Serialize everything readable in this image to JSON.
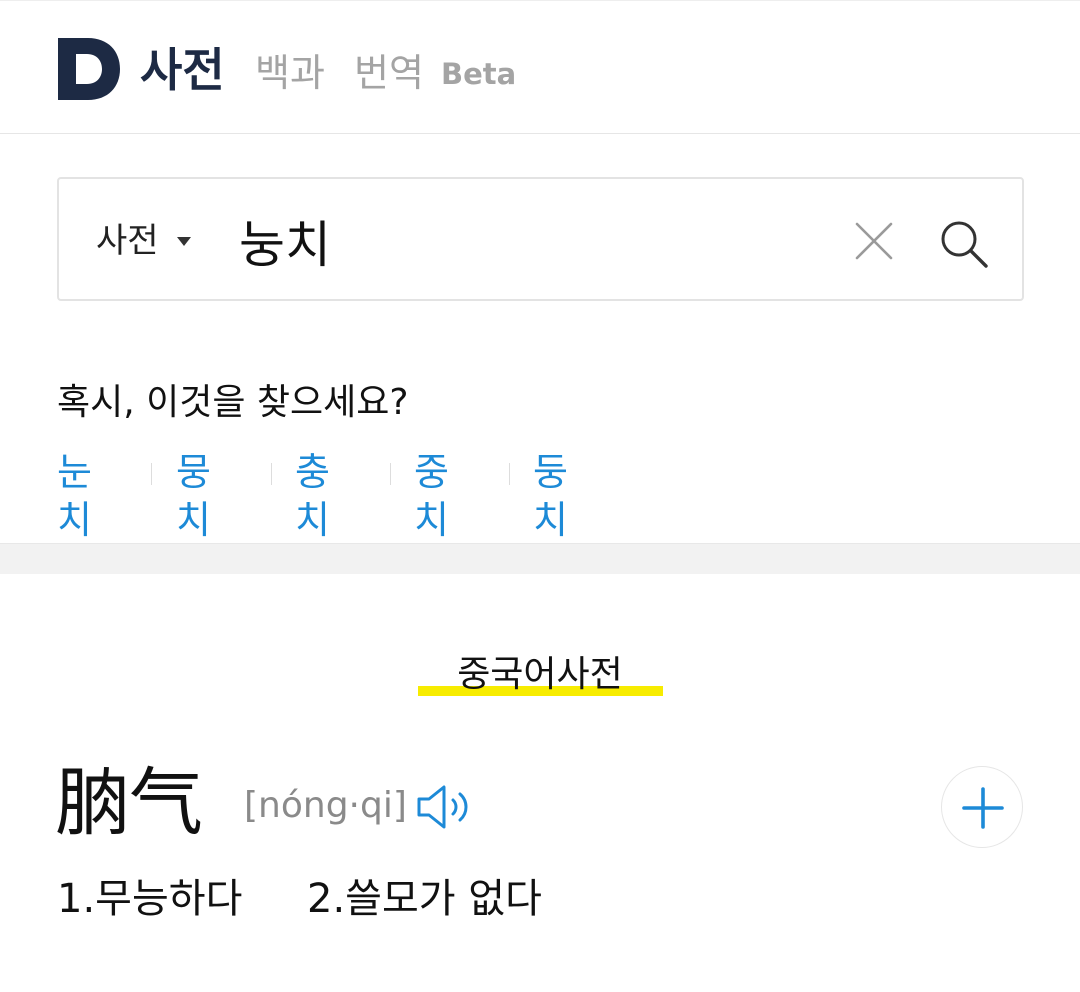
{
  "header": {
    "title": "사전",
    "nav": [
      {
        "label": "백과"
      },
      {
        "label": "번역"
      }
    ],
    "beta": "Beta",
    "colors": {
      "brand": "#1d2a44",
      "muted": "#a4a4a4"
    }
  },
  "search": {
    "category": "사전",
    "query": "눙치",
    "icons": {
      "caret": "caret-down-icon",
      "clear": "close-icon",
      "search": "search-icon"
    }
  },
  "suggestions": {
    "title": "혹시, 이것을 찾으세요?",
    "items": [
      "눈치",
      "뭉치",
      "충치",
      "중치",
      "둥치"
    ],
    "link_color": "#1d8ad7"
  },
  "section": {
    "heading": "중국어사전",
    "highlight_color": "#f7ec00"
  },
  "entry": {
    "word": "朒气",
    "pinyin": "[nóng·qi]",
    "meanings": [
      "1.무능하다",
      "2.쓸모가 없다"
    ],
    "icons": {
      "audio": "speaker-icon",
      "add": "plus-icon"
    }
  }
}
